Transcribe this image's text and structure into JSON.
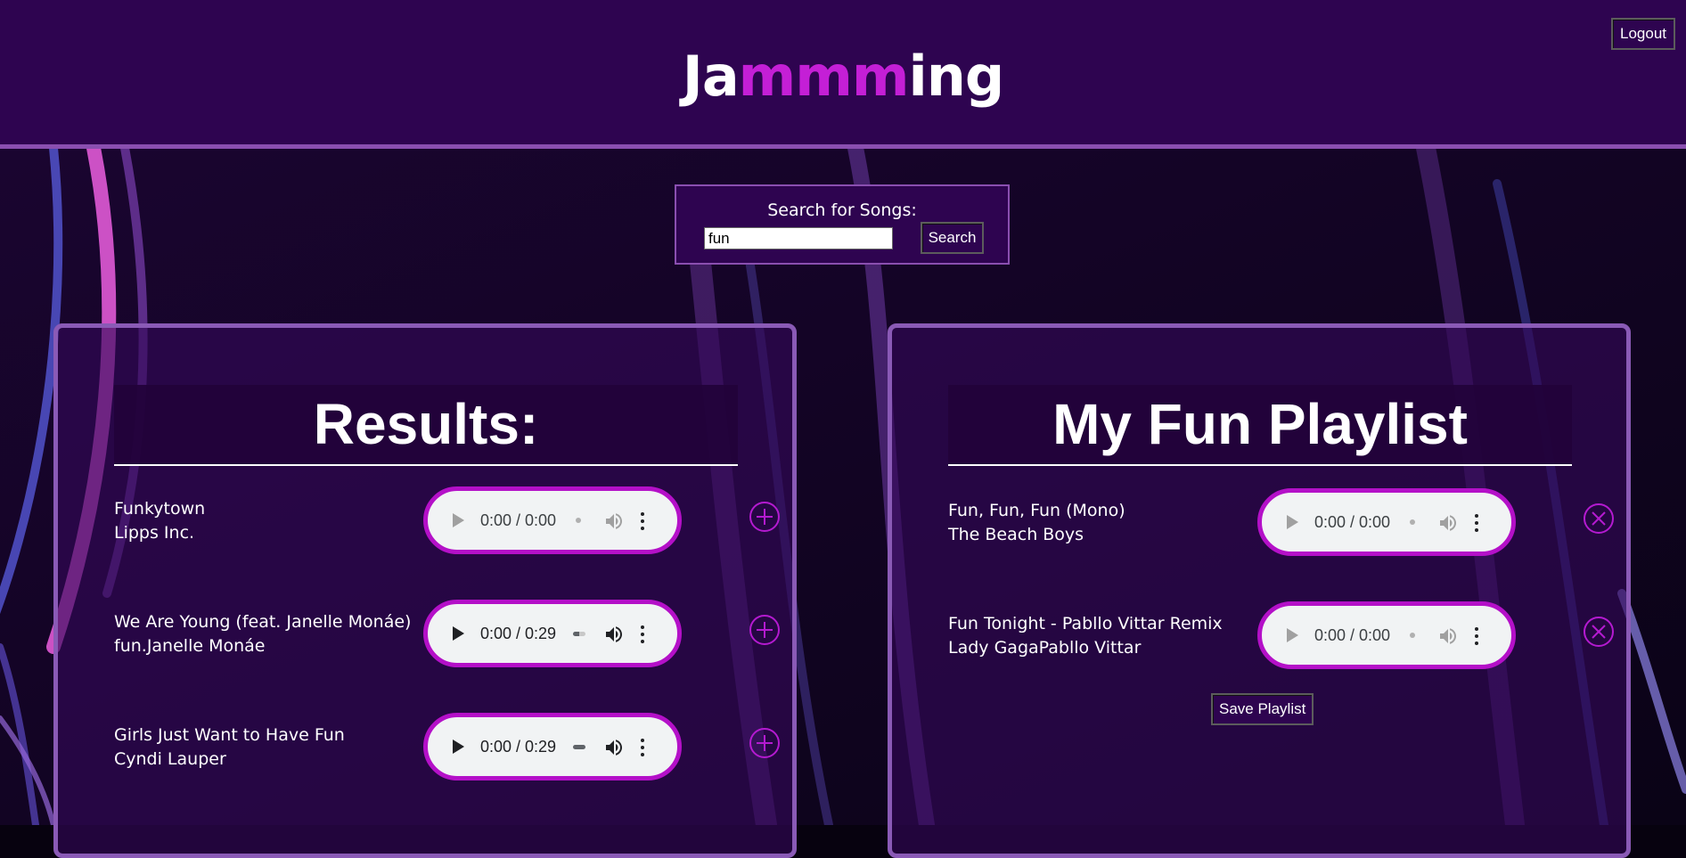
{
  "header": {
    "title_part1": "Ja",
    "title_highlight": "mmm",
    "title_part2": "ing",
    "logout_label": "Logout"
  },
  "search": {
    "label": "Search for Songs:",
    "value": "fun",
    "button_label": "Search"
  },
  "results": {
    "title": "Results:",
    "tracks": [
      {
        "name": "Funkytown",
        "artist": "Lipps Inc.",
        "time": "0:00 / 0:00",
        "playable": false
      },
      {
        "name": "We Are Young (feat. Janelle Monáe)",
        "artist": "fun.Janelle Monáe",
        "time": "0:00 / 0:29",
        "playable": true
      },
      {
        "name": "Girls Just Want to Have Fun",
        "artist": "Cyndi Lauper",
        "time": "0:00 / 0:29",
        "playable": true
      }
    ],
    "add_icon": "plus-circle-icon"
  },
  "playlist": {
    "title": "My Fun Playlist",
    "tracks": [
      {
        "name": "Fun, Fun, Fun (Mono)",
        "artist": "The Beach Boys",
        "time": "0:00 / 0:00",
        "playable": false
      },
      {
        "name": "Fun Tonight - Pabllo Vittar Remix",
        "artist": "Lady GagaPabllo Vittar",
        "time": "0:00 / 0:00",
        "playable": false
      }
    ],
    "remove_icon": "x-circle-icon",
    "save_label": "Save Playlist"
  },
  "colors": {
    "header_bg": "#2e0450",
    "accent": "#c41fd6",
    "panel_border": "#8a5ab6",
    "player_ring": "#b410c8"
  }
}
